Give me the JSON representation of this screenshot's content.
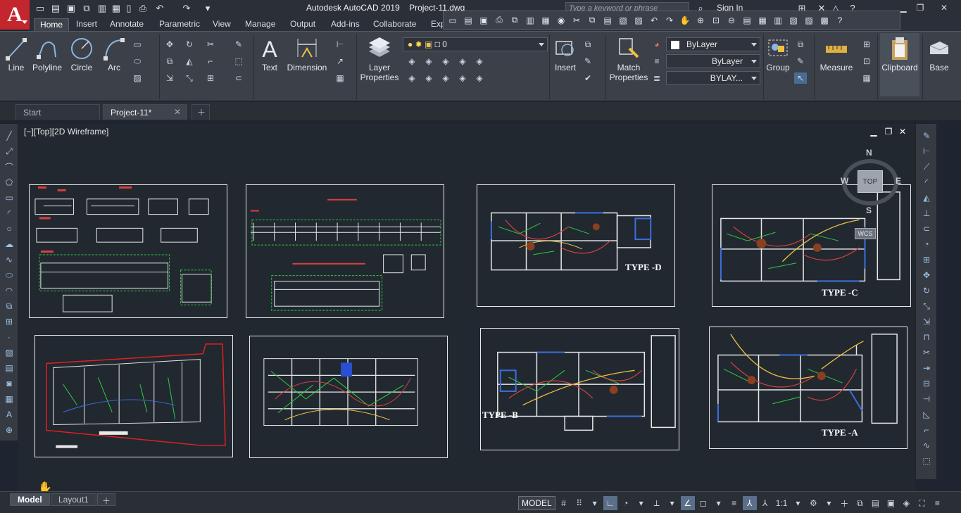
{
  "window": {
    "app_title": "Autodesk AutoCAD 2019",
    "file_title": "Project-11.dwg",
    "search_placeholder": "Type a keyword or phrase",
    "sign_in": "Sign In"
  },
  "ribbon_tabs": [
    "Home",
    "Insert",
    "Annotate",
    "Parametric",
    "View",
    "Manage",
    "Output",
    "Add-ins",
    "Collaborate",
    "Exp"
  ],
  "ribbon": {
    "draw": {
      "line": "Line",
      "polyline": "Polyline",
      "circle": "Circle",
      "arc": "Arc"
    },
    "annotation": {
      "text": "Text",
      "dimension": "Dimension"
    },
    "layers": {
      "layer_properties_line1": "Layer",
      "layer_properties_line2": "Properties",
      "current_layer": "0"
    },
    "block": {
      "insert": "Insert"
    },
    "properties": {
      "match_line1": "Match",
      "match_line2": "Properties",
      "color": "ByLayer",
      "linetype": "ByLayer",
      "lineweight": "BYLAY..."
    },
    "groups": {
      "group": "Group"
    },
    "utilities": {
      "measure": "Measure"
    },
    "clipboard": {
      "label": "Clipboard"
    },
    "view": {
      "base": "Base"
    }
  },
  "file_tabs": [
    {
      "label": "Start"
    },
    {
      "label": "Project-11*"
    }
  ],
  "viewport": {
    "label": "[−][Top][2D Wireframe]",
    "viewcube": {
      "north": "N",
      "south": "S",
      "east": "E",
      "west": "W",
      "top": "TOP",
      "wcs": "WCS"
    },
    "sheets": {
      "type_d": "TYPE -D",
      "type_c": "TYPE -C",
      "type_b": "TYPE -B",
      "type_a": "TYPE -A"
    }
  },
  "layout_tabs": [
    "Model",
    "Layout1"
  ],
  "status": {
    "model": "MODEL",
    "scale": "1:1"
  },
  "colors": {
    "accent": "#c4262e",
    "canvas": "#212830",
    "ribbon": "#3b4049"
  }
}
